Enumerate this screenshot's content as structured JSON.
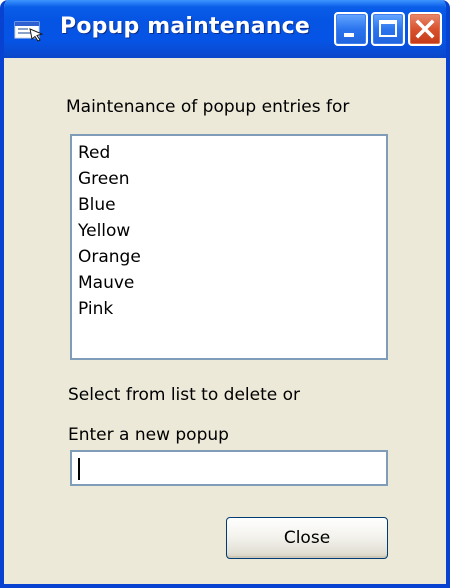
{
  "window": {
    "title": "Popup maintenance",
    "icon": "window-app-icon",
    "controls": {
      "minimize_icon": "minimize-icon",
      "maximize_icon": "maximize-icon",
      "close_icon": "close-icon"
    }
  },
  "form": {
    "heading": "Maintenance of popup entries for",
    "list_items": [
      "Red",
      "Green",
      "Blue",
      "Yellow",
      "Orange",
      "Mauve",
      "Pink"
    ],
    "select_hint": "Select from list to delete or",
    "enter_label": "Enter a new popup",
    "new_popup_value": "",
    "close_label": "Close"
  },
  "colors": {
    "titlebar": "#0554e3",
    "window_face": "#ece9d8",
    "close_button": "#d9522f",
    "field_border": "#7f9db9"
  }
}
